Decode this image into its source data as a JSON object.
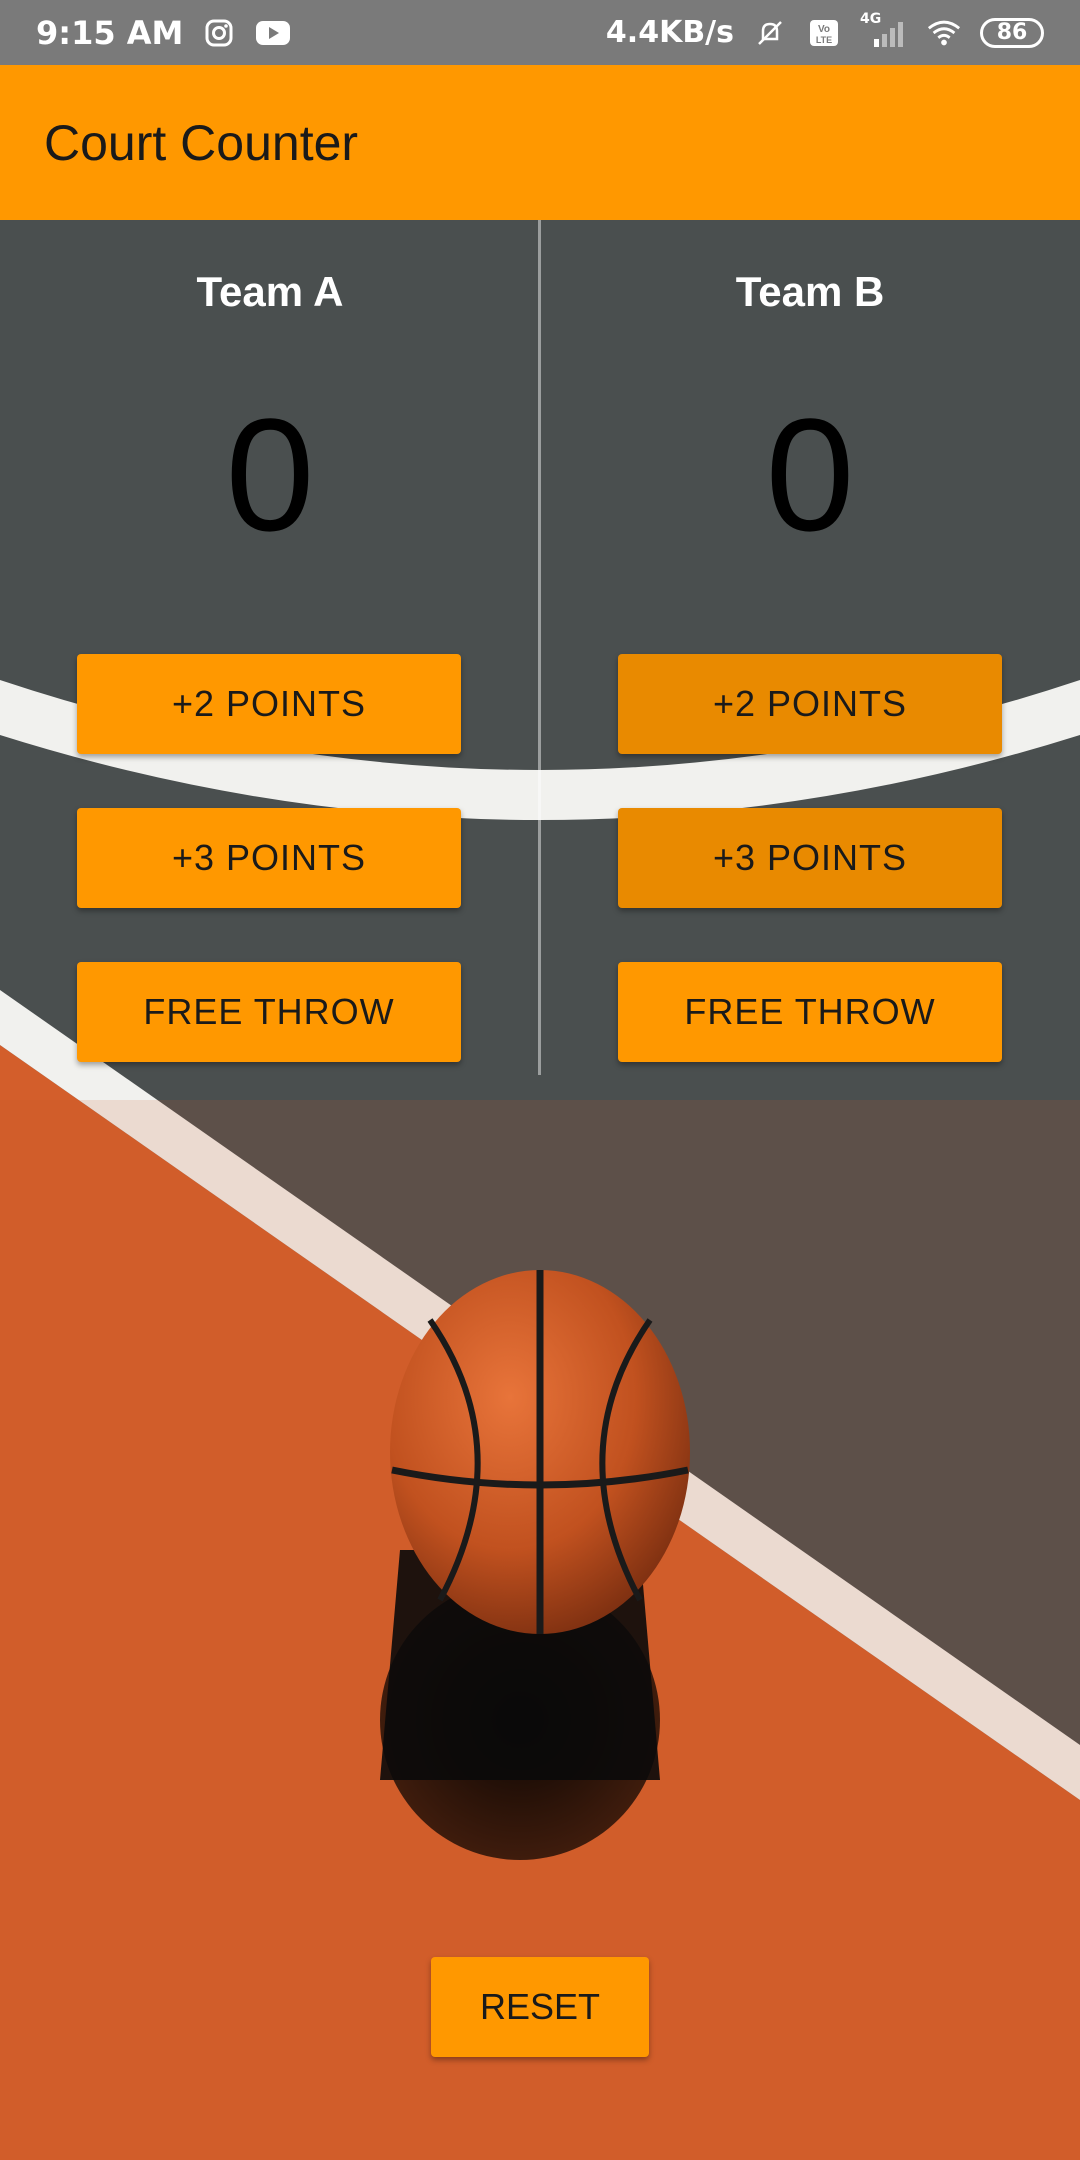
{
  "status_bar": {
    "time": "9:15 AM",
    "speed": "4.4KB/s",
    "battery": "86",
    "network": "4G",
    "icons": [
      "instagram-icon",
      "youtube-icon",
      "muted-bell-icon",
      "volte-icon",
      "signal-icon",
      "wifi-icon",
      "battery-icon"
    ]
  },
  "app_bar": {
    "title": "Court Counter"
  },
  "team_a": {
    "name": "Team A",
    "score": "0",
    "btn_2": "+2 POINTS",
    "btn_3": "+3 POINTS",
    "btn_ft": "FREE THROW"
  },
  "team_b": {
    "name": "Team B",
    "score": "0",
    "btn_2": "+2 POINTS",
    "btn_3": "+3 POINTS",
    "btn_ft": "FREE THROW"
  },
  "reset_label": "RESET",
  "colors": {
    "accent": "#ff9800",
    "court_grey": "#4a4f4f",
    "court_orange": "#d35e2b",
    "status_bar": "#7a7a7a"
  }
}
